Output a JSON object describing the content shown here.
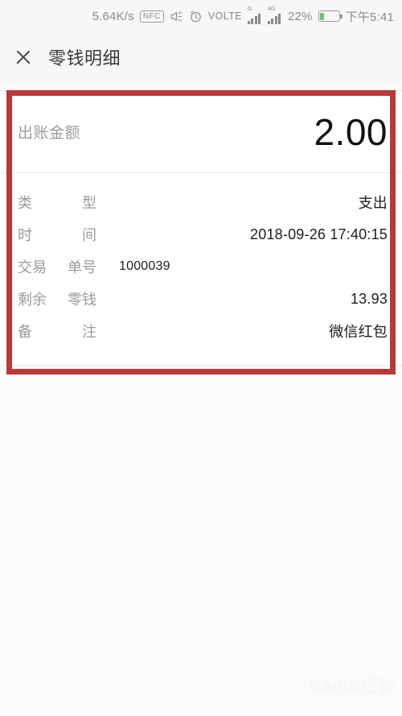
{
  "statusbar": {
    "net_speed": "5.64K/s",
    "nfc": "NFC",
    "mute_icon": "mute-icon",
    "alarm_icon": "alarm-icon",
    "volte": "VOLTE",
    "sim1_gen": "G",
    "sim2_gen": "4G",
    "battery_percent": "22%",
    "battery_level": 22,
    "time": "下午5:41"
  },
  "titlebar": {
    "close_icon": "close-icon",
    "title": "零钱明细"
  },
  "card": {
    "amount_label": "出账金额",
    "amount_value": "2.00",
    "rows": [
      {
        "label_a": "类",
        "label_b": "型",
        "value": "支出",
        "align": "right"
      },
      {
        "label_a": "时",
        "label_b": "间",
        "value": "2018-09-26 17:40:15",
        "align": "right"
      },
      {
        "label_a": "交易",
        "label_b": "单号",
        "value": "1000039",
        "align": "left"
      },
      {
        "label_a": "剩余",
        "label_b": "零钱",
        "value": "13.93",
        "align": "right"
      },
      {
        "label_a": "备",
        "label_b": "注",
        "value": "微信红包",
        "align": "right"
      }
    ]
  },
  "annotation": {
    "highlight_color": "#b9393b"
  },
  "watermark": {
    "main": "Baidu经验",
    "sub": "jingyan.baidu.com"
  }
}
